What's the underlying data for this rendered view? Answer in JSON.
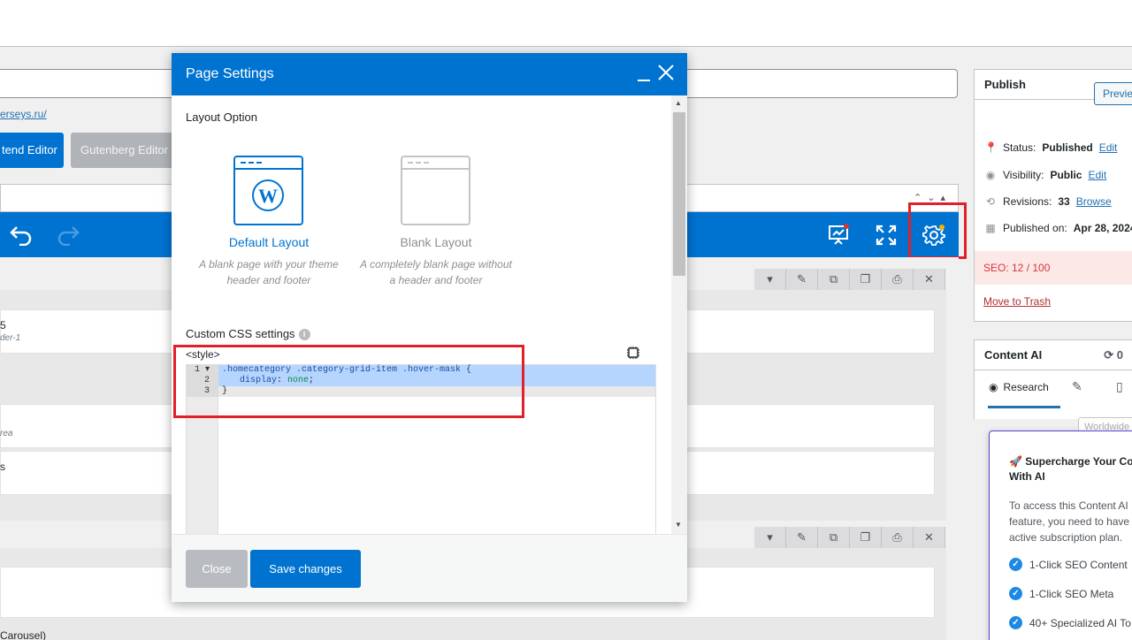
{
  "background": {
    "permalink_fragment": "erseys.ru/",
    "backend_editor_label": "tend Editor",
    "gutenberg_editor_label": "Gutenberg Editor",
    "elements": [
      {
        "title": "5",
        "subtitle": "der-1"
      },
      {
        "title": "",
        "subtitle": "rea"
      },
      {
        "title": "s",
        "subtitle": ""
      },
      {
        "title": "Carousel)",
        "subtitle": ""
      }
    ]
  },
  "publish": {
    "title": "Publish",
    "preview_label": "Preview",
    "status_label": "Status:",
    "status_value": "Published",
    "status_link": "Edit",
    "visibility_label": "Visibility:",
    "visibility_value": "Public",
    "visibility_link": "Edit",
    "revisions_label": "Revisions:",
    "revisions_value": "33",
    "revisions_link": "Browse",
    "published_label": "Published on:",
    "published_value": "Apr 28, 2024 a",
    "seo_label": "SEO: 12 / 100",
    "trash_label": "Move to Trash"
  },
  "content_ai": {
    "title": "Content AI",
    "credits": "0",
    "tab_research": "Research",
    "region_placeholder": "Worldwide",
    "popup_title": "🚀 Supercharge Your Co With AI",
    "popup_desc": "To access this Content AI feature, you need to have active subscription plan.",
    "features": [
      "1-Click SEO Content",
      "1-Click SEO Meta",
      "40+ Specialized AI To"
    ]
  },
  "modal": {
    "title": "Page Settings",
    "layout_option_label": "Layout Option",
    "layouts": [
      {
        "name": "Default Layout",
        "desc": "A blank page with your theme header and footer",
        "selected": true
      },
      {
        "name": "Blank Layout",
        "desc": "A completely blank page without a header and footer",
        "selected": false
      }
    ],
    "custom_css_label": "Custom CSS settings",
    "style_tag": "<style>",
    "code": {
      "line1_selector": ".homecategory .category-grid-item .hover-mask {",
      "line2_prop": "display",
      "line2_value": "none",
      "line3": "}"
    },
    "line_numbers": [
      "1",
      "2",
      "3"
    ],
    "close_label": "Close",
    "save_label": "Save changes"
  },
  "colors": {
    "primary": "#0073d1",
    "highlight_red": "#e0202a"
  }
}
